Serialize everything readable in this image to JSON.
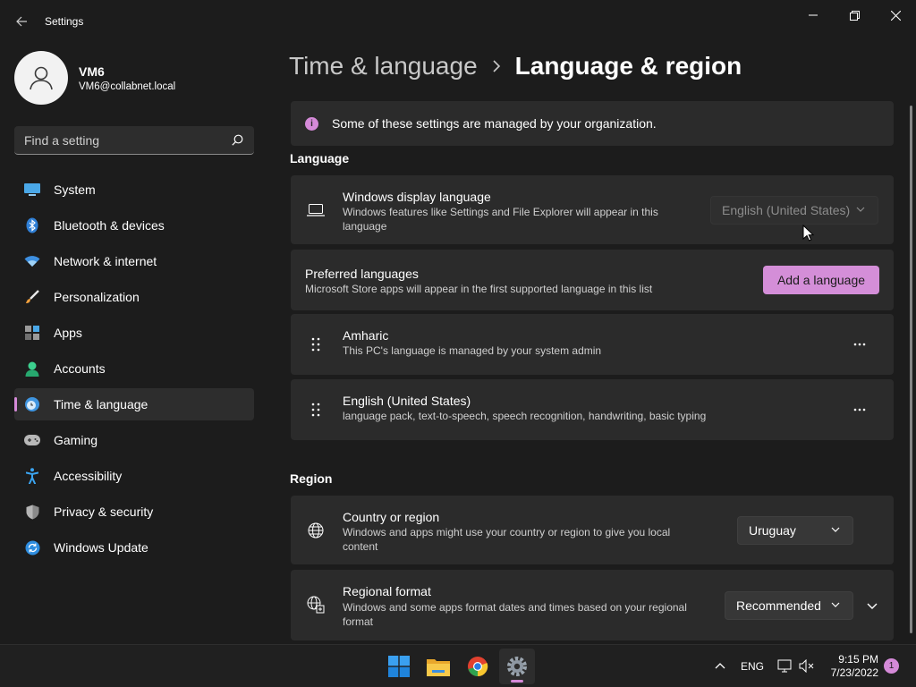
{
  "window": {
    "title": "Settings"
  },
  "profile": {
    "name": "VM6",
    "email": "VM6@collabnet.local"
  },
  "search": {
    "placeholder": "Find a setting"
  },
  "sidebar": {
    "items": [
      {
        "label": "System",
        "icon": "system-icon"
      },
      {
        "label": "Bluetooth & devices",
        "icon": "bluetooth-icon"
      },
      {
        "label": "Network & internet",
        "icon": "wifi-icon"
      },
      {
        "label": "Personalization",
        "icon": "brush-icon"
      },
      {
        "label": "Apps",
        "icon": "apps-icon"
      },
      {
        "label": "Accounts",
        "icon": "accounts-icon"
      },
      {
        "label": "Time & language",
        "icon": "time-language-icon",
        "active": true
      },
      {
        "label": "Gaming",
        "icon": "gaming-icon"
      },
      {
        "label": "Accessibility",
        "icon": "accessibility-icon"
      },
      {
        "label": "Privacy & security",
        "icon": "shield-icon"
      },
      {
        "label": "Windows Update",
        "icon": "update-icon"
      }
    ]
  },
  "breadcrumb": {
    "parent": "Time & language",
    "current": "Language & region"
  },
  "notice": {
    "text": "Some of these settings are managed by your organization."
  },
  "language_section": {
    "title": "Language",
    "display_language": {
      "title": "Windows display language",
      "desc_line1": "Windows features like Settings and File Explorer will appear in this",
      "desc_line2": "language",
      "value": "English (United States)"
    },
    "preferred": {
      "title": "Preferred languages",
      "desc": "Microsoft Store apps will appear in the first supported language in this list",
      "button": "Add a language"
    },
    "languages": [
      {
        "name": "Amharic",
        "desc": "This PC's language is managed by your system admin"
      },
      {
        "name": "English (United States)",
        "desc": "language pack, text-to-speech, speech recognition, handwriting, basic typing"
      }
    ]
  },
  "region_section": {
    "title": "Region",
    "country": {
      "title": "Country or region",
      "desc_line1": "Windows and apps might use your country or region to give you local",
      "desc_line2": "content",
      "value": "Uruguay"
    },
    "format": {
      "title": "Regional format",
      "desc_line1": "Windows and some apps format dates and times based on your regional",
      "desc_line2": "format",
      "value": "Recommended"
    }
  },
  "taskbar": {
    "apps": [
      "start-icon",
      "file-explorer-icon",
      "chrome-icon",
      "settings-icon"
    ],
    "language": "ENG",
    "time": "9:15 PM",
    "date": "7/23/2022",
    "notifications": "1"
  },
  "colors": {
    "accent": "#d58ad8",
    "background": "#1c1c1c",
    "card": "#2b2b2b"
  }
}
